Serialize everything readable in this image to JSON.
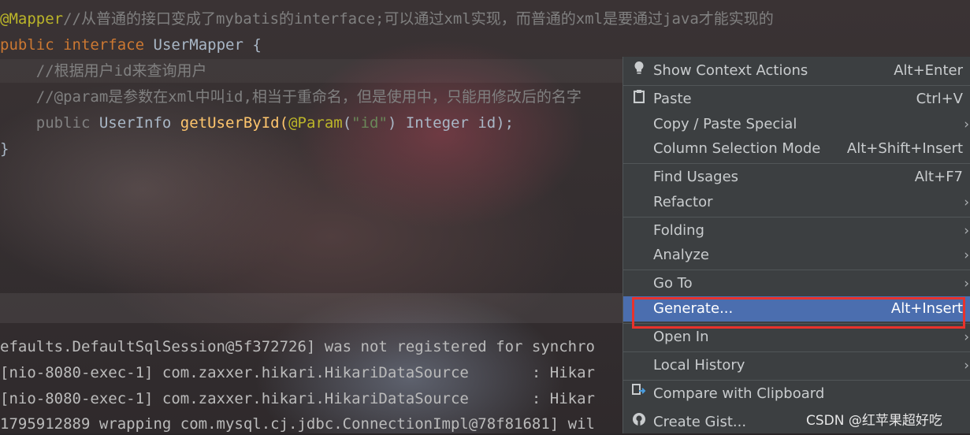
{
  "editor": {
    "line1": {
      "annotation": "@Mapper",
      "comment": "//从普通的接口变成了mybatis的interface;可以通过xml实现，而普通的xml是要通过java才能实现的"
    },
    "line2": {
      "kw1": "public",
      "kw2": "interface",
      "name": "UserMapper",
      "brace": " {"
    },
    "line3": {
      "comment": "    //根据用户id来查询用户"
    },
    "line4": {
      "comment": "    //@param是参数在xml中叫id,相当于重命名，但是使用中，只能用修改后的名字"
    },
    "line5": {
      "indent_kw": "    public",
      "type": " UserInfo ",
      "method": "getUserById",
      "open": "(",
      "ann": "@Param",
      "p1": "(",
      "str": "\"id\"",
      "rest": ") Integer id);"
    },
    "line6": {
      "brace": "}"
    }
  },
  "console": {
    "lines": [
      "efaults.DefaultSqlSession@5f372726] was not registered for synchro",
      "[nio-8080-exec-1] com.zaxxer.hikari.HikariDataSource       : Hikar",
      "[nio-8080-exec-1] com.zaxxer.hikari.HikariDataSource       : Hikar",
      "1795912889 wrapping com.mysql.cj.jdbc.ConnectionImpl@78f81681] wil"
    ]
  },
  "menu": {
    "items": [
      {
        "label": "Show Context Actions",
        "shortcut": "Alt+Enter",
        "icon": "lightbulb-icon"
      },
      {
        "label": "Paste",
        "shortcut": "Ctrl+V",
        "icon": "clipboard-icon"
      },
      {
        "label": "Copy / Paste Special",
        "submenu": true
      },
      {
        "label": "Column Selection Mode",
        "shortcut": "Alt+Shift+Insert"
      },
      {
        "label": "Find Usages",
        "shortcut": "Alt+F7"
      },
      {
        "label": "Refactor",
        "submenu": true
      },
      {
        "label": "Folding",
        "submenu": true
      },
      {
        "label": "Analyze",
        "submenu": true
      },
      {
        "label": "Go To",
        "submenu": true
      },
      {
        "label": "Generate...",
        "shortcut": "Alt+Insert",
        "selected": true
      },
      {
        "label": "Open In",
        "submenu": true
      },
      {
        "label": "Local History",
        "submenu": true
      },
      {
        "label": "Compare with Clipboard",
        "icon": "compare-icon"
      },
      {
        "label": "Create Gist...",
        "icon": "github-icon"
      }
    ],
    "submenu_arrow": "›"
  },
  "watermark": "CSDN @红苹果超好吃",
  "colors": {
    "selection": "#4b6eaf",
    "highlight_box": "#e8322c",
    "menu_bg": "#3c3f41"
  }
}
